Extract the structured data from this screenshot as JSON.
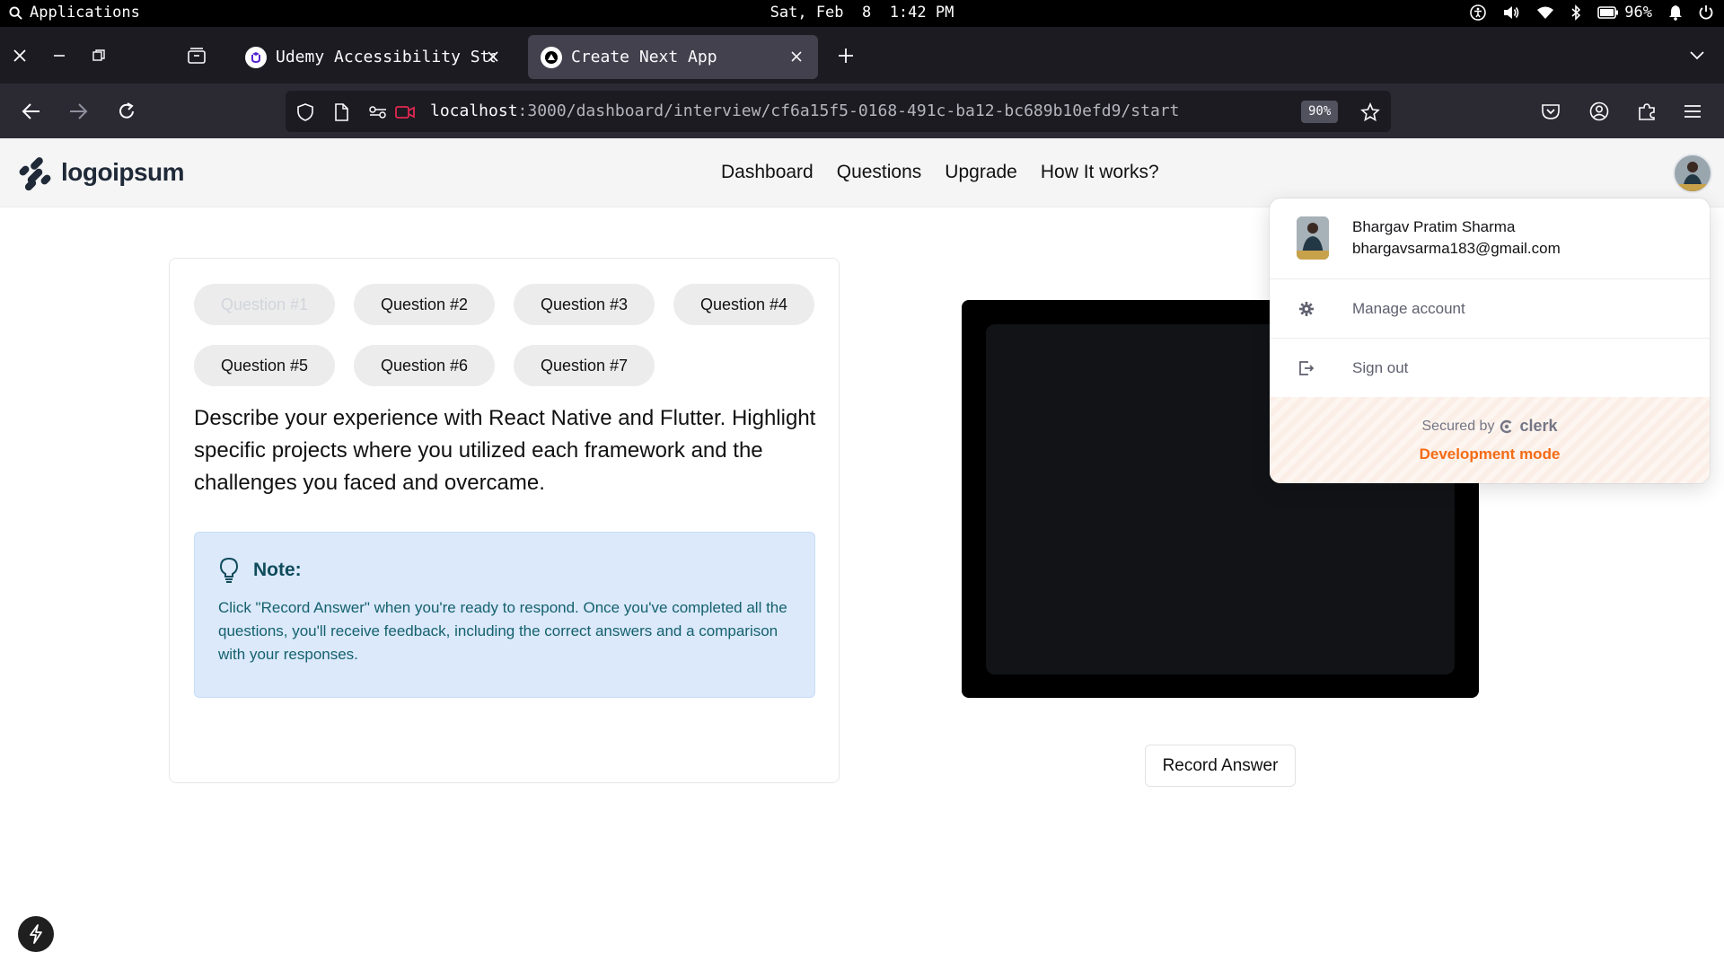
{
  "system_bar": {
    "activities_label": "Applications",
    "datetime": "Sat, Feb  8  1:42 PM",
    "battery_percent": "96%"
  },
  "browser": {
    "tabs": [
      {
        "title": "Udemy Accessibility Sta",
        "favicon": "udemy-icon",
        "active": false
      },
      {
        "title": "Create Next App",
        "favicon": "nextjs-triangle-icon",
        "active": true
      }
    ],
    "url_host": "localhost",
    "url_rest": ":3000/dashboard/interview/cf6a15f5-0168-491c-ba12-bc689b10efd9/start",
    "zoom": "90%"
  },
  "site": {
    "logo_text": "logoipsum",
    "nav": [
      "Dashboard",
      "Questions",
      "Upgrade",
      "How It works?"
    ]
  },
  "interview": {
    "questions": [
      "Question #1",
      "Question #2",
      "Question #3",
      "Question #4",
      "Question #5",
      "Question #6",
      "Question #7"
    ],
    "active_question": "Question #1",
    "question_text": "Describe your experience with React Native and Flutter. Highlight specific projects where you utilized each framework and the challenges you faced and overcame.",
    "note_title": "Note:",
    "note_body": "Click \"Record Answer\" when you're ready to respond. Once you've completed all the questions, you'll receive feedback, including the correct answers and a comparison with your responses.",
    "record_label": "Record Answer"
  },
  "user_menu": {
    "name": "Bhargav Pratim Sharma",
    "email": "bhargavsarma183@gmail.com",
    "manage_label": "Manage account",
    "signout_label": "Sign out",
    "secured_by": "Secured by",
    "brand": "clerk",
    "dev_mode": "Development mode"
  },
  "colors": {
    "accent_orange": "#f36b16",
    "note_bg": "#dbe9fb",
    "note_text": "#15616d",
    "browser_dark": "#1c1b22"
  }
}
